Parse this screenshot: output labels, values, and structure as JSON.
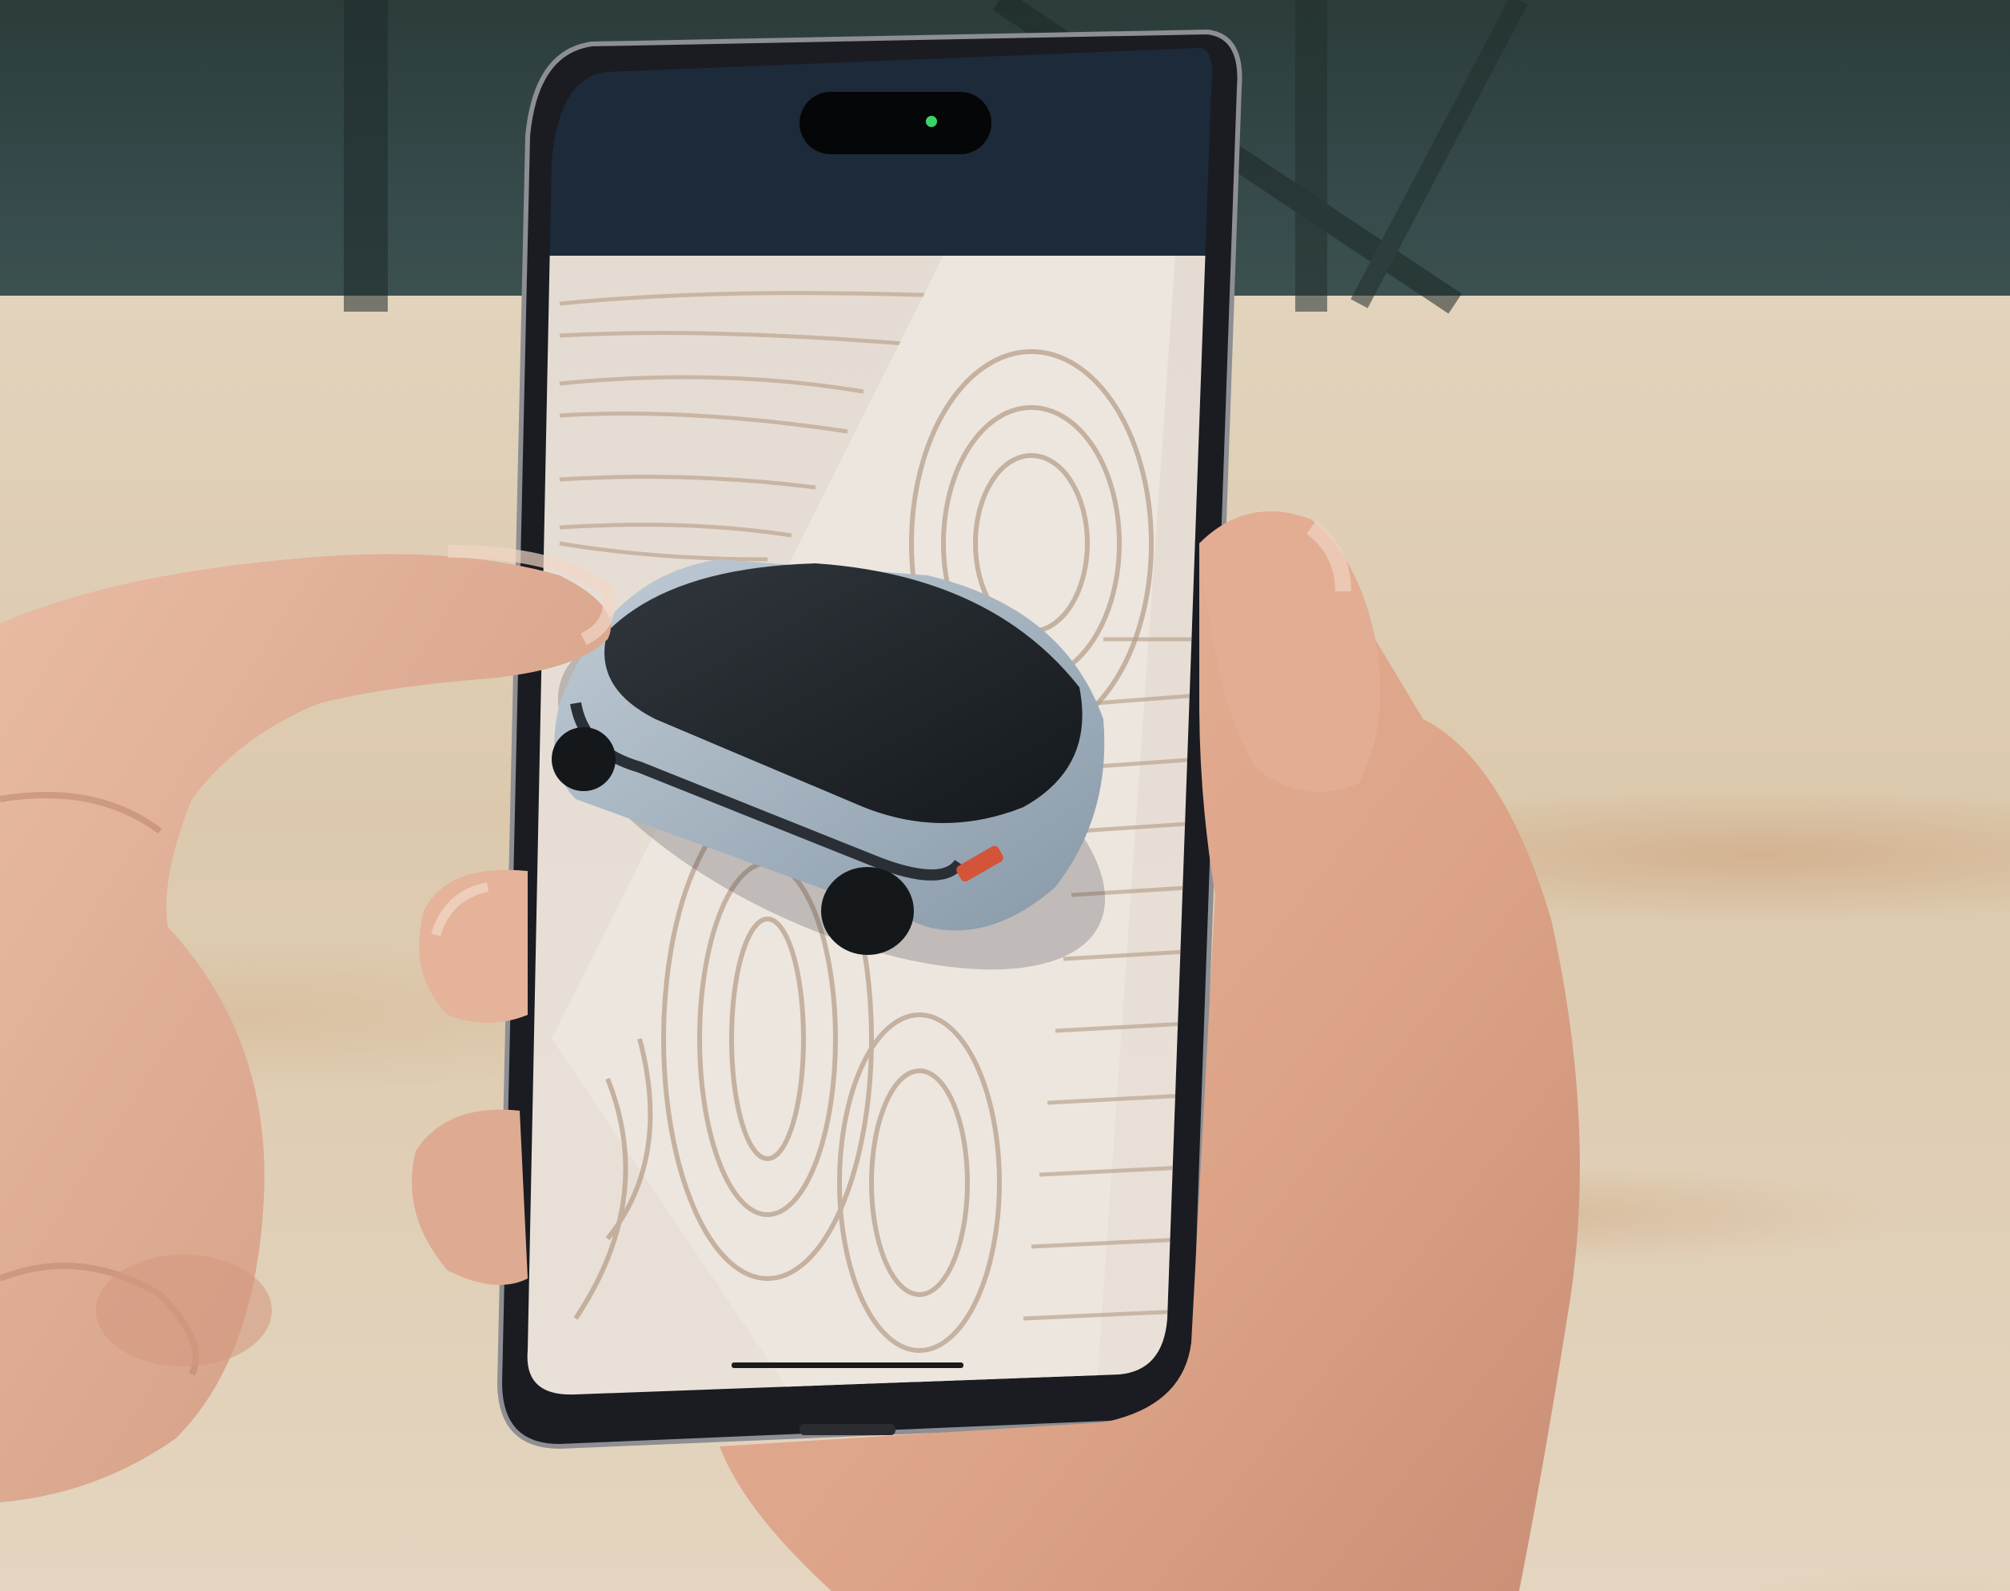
{
  "scene": {
    "description_id": "ar-car-view",
    "colors": {
      "wall": "#35494a",
      "table": "#dcc9ad",
      "phone_frame": "#1a1c22",
      "skin": "#e0ad94",
      "car_body": "#a7b6c2",
      "car_roof": "#1e2328"
    }
  },
  "phone": {
    "screen": {
      "content": "ar-car-on-wood-surface"
    }
  }
}
